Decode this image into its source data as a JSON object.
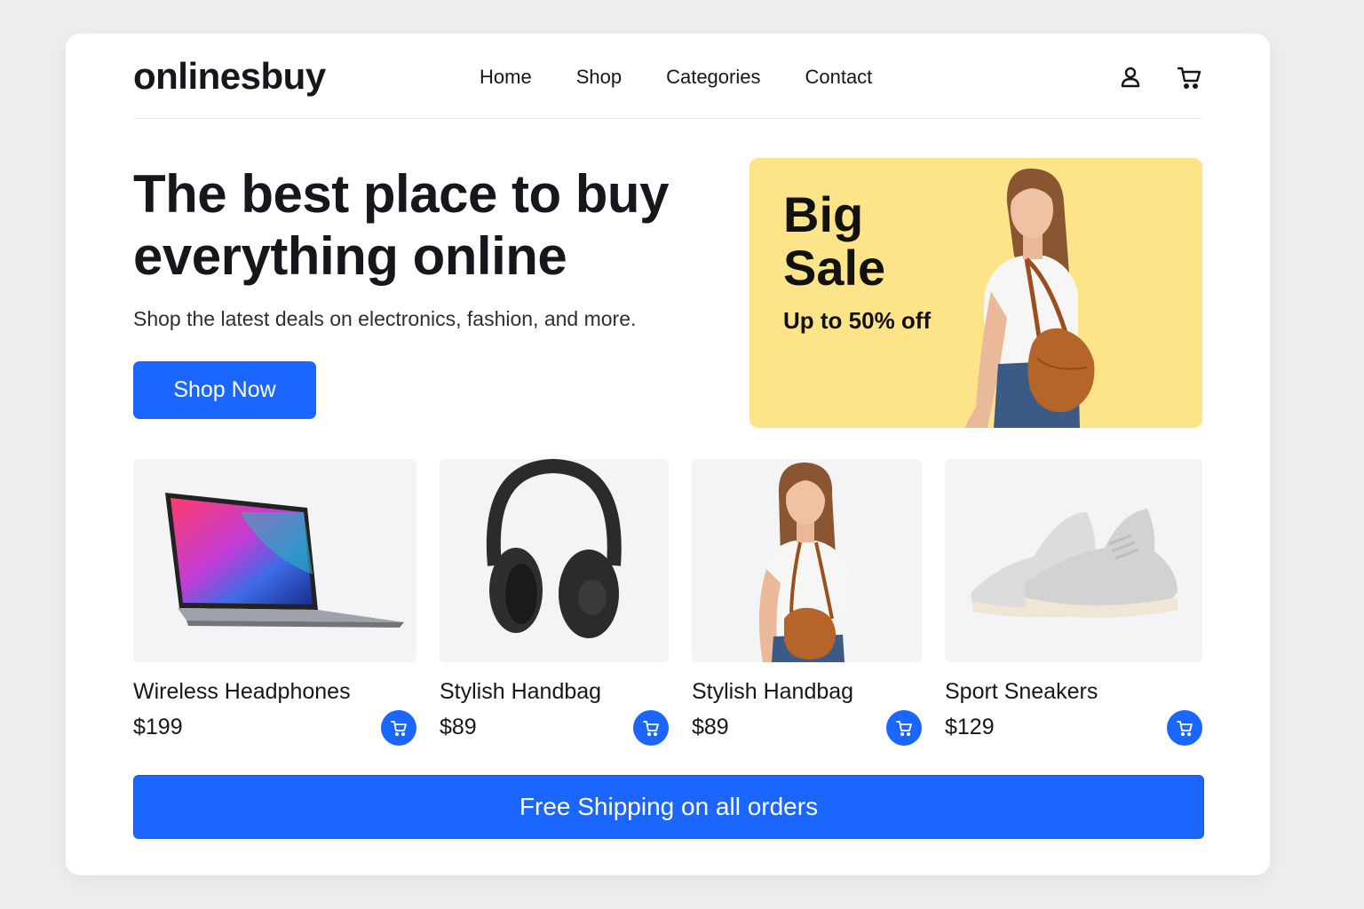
{
  "header": {
    "logo": "onlinesbuy",
    "nav": [
      "Home",
      "Shop",
      "Categories",
      "Contact"
    ],
    "icons": [
      "user-icon",
      "cart-icon"
    ]
  },
  "hero": {
    "title_line1": "The best place to buy",
    "title_line2": "everything online",
    "subtitle": "Shop the latest deals on electronics, fashion, and more.",
    "cta": "Shop Now"
  },
  "sale_banner": {
    "title_line1": "Big",
    "title_line2": "Sale",
    "subtitle": "Up to 50% off",
    "background": "#fde488"
  },
  "products": [
    {
      "name": "Wireless Headphones",
      "price": "$199",
      "image": "laptop"
    },
    {
      "name": "Stylish Handbag",
      "price": "$89",
      "image": "headphones"
    },
    {
      "name": "Stylish Handbag",
      "price": "$89",
      "image": "woman-with-handbag"
    },
    {
      "name": "Sport Sneakers",
      "price": "$129",
      "image": "sneakers"
    }
  ],
  "banner": {
    "text": "Free Shipping on all orders"
  },
  "colors": {
    "accent": "#1a66ff",
    "text": "#15171c",
    "card": "#ffffff",
    "page": "#efeeec"
  }
}
